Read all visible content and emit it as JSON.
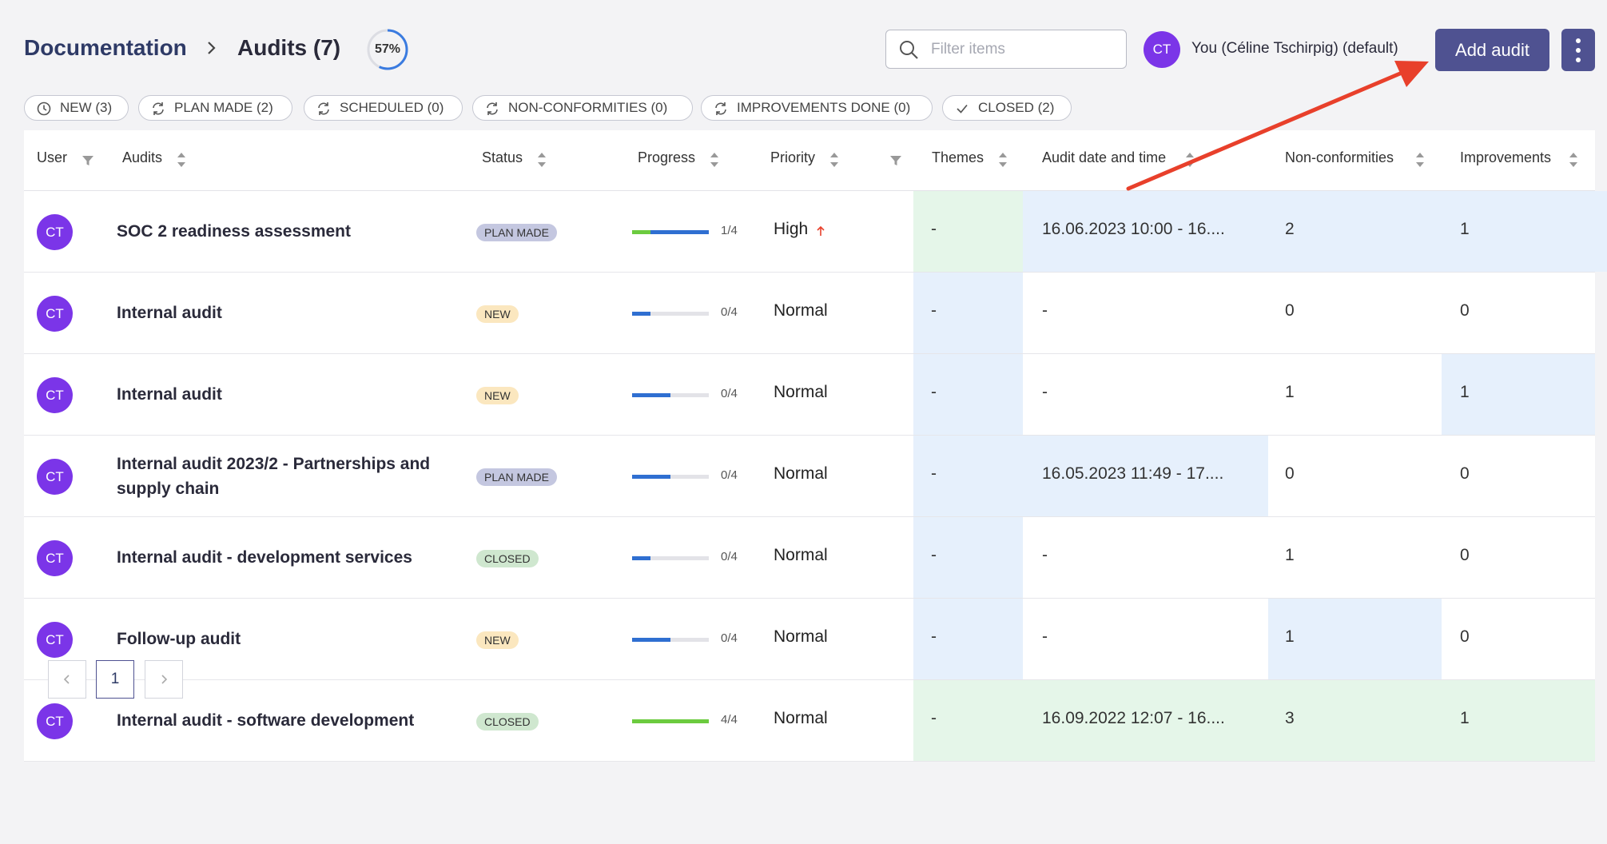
{
  "breadcrumb": {
    "root": "Documentation",
    "current": "Audits (7)"
  },
  "completion": {
    "label": "57%",
    "fraction": 0.57
  },
  "filter": {
    "placeholder": "Filter items"
  },
  "user": {
    "initials": "CT",
    "name": "You (Céline Tschirpig) (default)"
  },
  "actions": {
    "add_label": "Add audit"
  },
  "chips": [
    {
      "label": "NEW (3)",
      "icon": "clock-icon"
    },
    {
      "label": "PLAN MADE (2)",
      "icon": "refresh-icon"
    },
    {
      "label": "SCHEDULED (0)",
      "icon": "refresh-icon"
    },
    {
      "label": "NON-CONFORMITIES (0)",
      "icon": "refresh-icon"
    },
    {
      "label": "IMPROVEMENTS DONE (0)",
      "icon": "refresh-icon"
    },
    {
      "label": "CLOSED (2)",
      "icon": "check-icon"
    }
  ],
  "columns": {
    "user": "User",
    "audits": "Audits",
    "status": "Status",
    "progress": "Progress",
    "priority": "Priority",
    "themes": "Themes",
    "date": "Audit date and time",
    "nonconformities": "Non-conformities",
    "improvements": "Improvements"
  },
  "rows": [
    {
      "initials": "CT",
      "name": "SOC 2 readiness assessment",
      "status": "PLAN MADE",
      "progress": "1/4",
      "progress_fraction": 0.25,
      "priority": "High",
      "themes": "-",
      "date": "16.06.2023 10:00 - 16....",
      "nonconformities": "2",
      "improvements": "1"
    },
    {
      "initials": "CT",
      "name": "Internal audit",
      "status": "NEW",
      "progress": "0/4",
      "progress_fraction": 0,
      "priority": "Normal",
      "themes": "-",
      "date": "-",
      "nonconformities": "0",
      "improvements": "0"
    },
    {
      "initials": "CT",
      "name": "Internal audit",
      "status": "NEW",
      "progress": "0/4",
      "progress_fraction": 0,
      "priority": "Normal",
      "themes": "-",
      "date": "-",
      "nonconformities": "1",
      "improvements": "1"
    },
    {
      "initials": "CT",
      "name": "Internal audit 2023/2 - Partnerships and supply chain",
      "status": "PLAN MADE",
      "progress": "0/4",
      "progress_fraction": 0,
      "priority": "Normal",
      "themes": "-",
      "date": "16.05.2023 11:49 - 17....",
      "nonconformities": "0",
      "improvements": "0"
    },
    {
      "initials": "CT",
      "name": "Internal audit - development services",
      "status": "CLOSED",
      "progress": "0/4",
      "progress_fraction": 0,
      "priority": "Normal",
      "themes": "-",
      "date": "-",
      "nonconformities": "1",
      "improvements": "0"
    },
    {
      "initials": "CT",
      "name": "Follow-up audit",
      "status": "NEW",
      "progress": "0/4",
      "progress_fraction": 0,
      "priority": "Normal",
      "themes": "-",
      "date": "-",
      "nonconformities": "1",
      "improvements": "0"
    },
    {
      "initials": "CT",
      "name": "Internal audit - software development",
      "status": "CLOSED",
      "progress": "4/4",
      "progress_fraction": 1,
      "priority": "Normal",
      "themes": "-",
      "date": "16.09.2022 12:07 - 16....",
      "nonconformities": "3",
      "improvements": "1"
    }
  ],
  "pagination": {
    "current": "1"
  },
  "colors": {
    "accent": "#4f5291",
    "avatar": "#7b35e8",
    "progress_blue": "#2f6fd1",
    "progress_green": "#6ccb3f",
    "annotation": "#e8402b"
  }
}
